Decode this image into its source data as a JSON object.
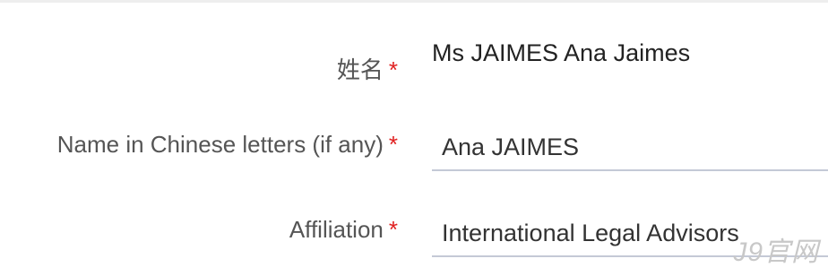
{
  "form": {
    "name_label": "姓名",
    "name_value": "Ms JAIMES Ana Jaimes",
    "chinese_name_label": "Name in Chinese letters (if any)",
    "chinese_name_value": "Ana JAIMES",
    "affiliation_label": "Affiliation",
    "affiliation_value": "International Legal Advisors",
    "required_marker": "*"
  },
  "watermark": {
    "text": "J9官网"
  }
}
